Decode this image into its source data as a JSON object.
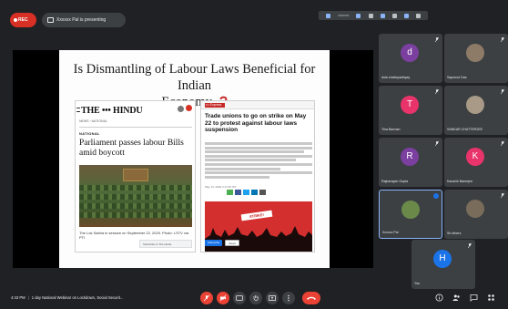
{
  "recording": {
    "label": "REC"
  },
  "presenting": {
    "label": "Xxxxxx Pal is presenting"
  },
  "toolbar_strip": {
    "label": "xxxxxxx"
  },
  "slide": {
    "title_line1": "Is Dismantling of Labour Laws Beneficial for Indian",
    "title_line2": "Economy"
  },
  "article1": {
    "masthead": "THE ••• HINDU",
    "crumbs": "NEWS › NATIONAL",
    "section": "NATIONAL",
    "headline": "Parliament passes labour Bills amid boycott",
    "caption": "The Lok Sabha in session on September 22, 2020. Photo: LSTV via PTI",
    "footer": "Subscribe to The Hindu"
  },
  "article2": {
    "logo": "••• Express",
    "headline": "Trade unions to go on strike on May 22 to protest against labour laws suspension",
    "date": "May 13, 2020 2:47:56 IST",
    "banner": "STRIKE!",
    "btn_primary": "Subscribe",
    "btn_secondary": "Read"
  },
  "participants": [
    {
      "initial": "d",
      "name": "dola chattopadhyay",
      "color": "#7b3fa0"
    },
    {
      "initial": "",
      "name": "Sapnmoi Das",
      "color": ""
    },
    {
      "initial": "T",
      "name": "Tina Barman",
      "color": "#e8336b"
    },
    {
      "initial": "",
      "name": "SANKAR CHATTERJEE",
      "color": ""
    },
    {
      "initial": "R",
      "name": "Rajnarayan Gupta",
      "color": "#7b3fa0"
    },
    {
      "initial": "K",
      "name": "Kaushik Banerjee",
      "color": "#e8336b"
    },
    {
      "initial": "",
      "name": "Xxxxxx Pal",
      "color": ""
    },
    {
      "initial": "",
      "name": "Sri others",
      "color": ""
    },
    {
      "initial": "H",
      "name": "You",
      "color": "#1a73e8"
    }
  ],
  "bottom": {
    "time": "4:43 PM",
    "meeting_title": "1 day National Webinar on Lockdown, Social Securit..."
  },
  "colors": {
    "accent": "#8ab4f8",
    "danger": "#ea4335",
    "tile": "#3c4043",
    "background": "#202124"
  }
}
